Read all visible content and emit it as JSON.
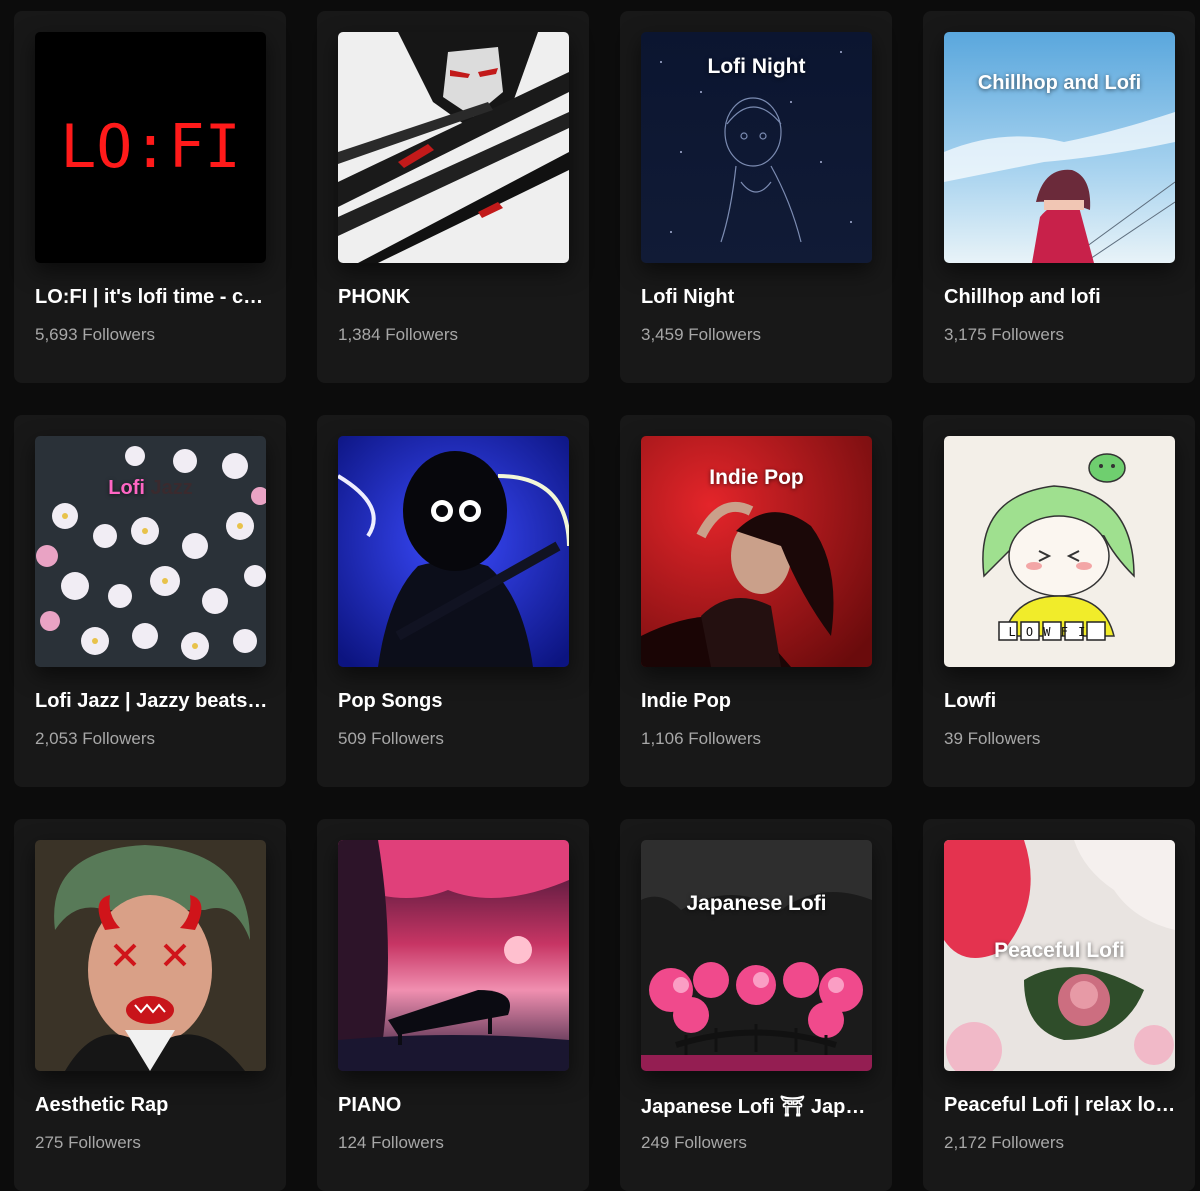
{
  "playlists": [
    {
      "title": "LO:FI | it's lofi time - c…",
      "followers": "5,693 Followers",
      "cover_text": "LO:FI",
      "cover_icon": "lofi-clock-icon"
    },
    {
      "title": "PHONK",
      "followers": "1,384 Followers",
      "cover_icon": "samurai-art-icon"
    },
    {
      "title": "Lofi Night",
      "followers": "3,459 Followers",
      "cover_text": "Lofi Night",
      "cover_icon": "night-sky-girl-icon"
    },
    {
      "title": "Chillhop and lofi",
      "followers": "3,175 Followers",
      "cover_text": "Chillhop and Lofi",
      "cover_icon": "sky-girl-icon"
    },
    {
      "title": "Lofi Jazz | Jazzy beats…",
      "followers": "2,053 Followers",
      "cover_text_a": "Lofi",
      "cover_text_b": "Jazz",
      "cover_icon": "cherry-blossom-icon"
    },
    {
      "title": "Pop Songs",
      "followers": "509 Followers",
      "cover_icon": "hooded-guitarist-icon"
    },
    {
      "title": "Indie Pop",
      "followers": "1,106 Followers",
      "cover_text": "Indie Pop",
      "cover_icon": "red-portrait-icon"
    },
    {
      "title": "Lowfi",
      "followers": "39 Followers",
      "cover_text": "LOWFI",
      "cover_icon": "green-hair-girl-icon"
    },
    {
      "title": "Aesthetic Rap",
      "followers": "275 Followers",
      "cover_icon": "devil-portrait-icon"
    },
    {
      "title": "PIANO",
      "followers": "124 Followers",
      "cover_icon": "piano-sunset-icon"
    },
    {
      "title": "Japanese Lofi ⛩ Jap…",
      "followers": "249 Followers",
      "cover_text": "Japanese Lofi",
      "cover_icon": "sakura-bridge-icon"
    },
    {
      "title": "Peaceful Lofi | relax lo…",
      "followers": "2,172 Followers",
      "cover_text": "Peaceful Lofi",
      "cover_icon": "peony-flowers-icon"
    }
  ],
  "colors": {
    "page_background": "#0c0c0c",
    "card_background": "#181818",
    "title_text": "#ffffff",
    "followers_text": "#a7a7a7",
    "lofi_digits": "#ff1a1a",
    "lofi_jazz_pink": "#ff66c4"
  }
}
